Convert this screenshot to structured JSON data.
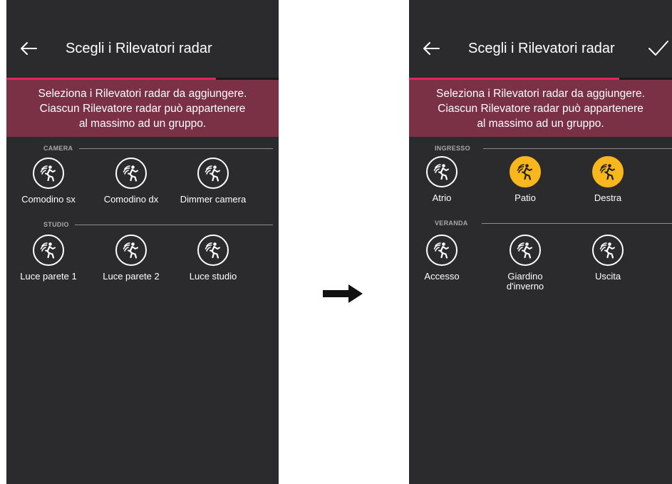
{
  "colors": {
    "background": "#2b2b2d",
    "accent": "#e0265b",
    "banner": "#7a3045",
    "selected": "#f7b71d"
  },
  "screens": [
    {
      "title": "Scegli i Rilevatori radar",
      "progress": 0.77,
      "instruction": [
        "Seleziona i Rilevatori radar da aggiungere.",
        "Ciascun Rilevatore radar può appartenere",
        "al massimo ad un gruppo."
      ],
      "groups": [
        {
          "name": "CAMERA",
          "devices": [
            {
              "label": "Comodino sx",
              "selected": false,
              "icon": "radar-motion-icon"
            },
            {
              "label": "Comodino dx",
              "selected": false,
              "icon": "radar-motion-icon"
            },
            {
              "label": "Dimmer camera",
              "selected": false,
              "icon": "radar-motion-icon"
            }
          ]
        },
        {
          "name": "STUDIO",
          "devices": [
            {
              "label": "Luce parete 1",
              "selected": false,
              "icon": "radar-motion-icon"
            },
            {
              "label": "Luce parete 2",
              "selected": false,
              "icon": "radar-motion-icon"
            },
            {
              "label": "Luce studio",
              "selected": false,
              "icon": "radar-motion-icon"
            }
          ]
        }
      ]
    },
    {
      "title": "Scegli i Rilevatori radar",
      "progress": 0.8,
      "show_confirm": true,
      "instruction": [
        "Seleziona i Rilevatori radar da aggiungere.",
        "Ciascun Rilevatore radar può appartenere",
        "al massimo ad un gruppo."
      ],
      "groups": [
        {
          "name": "INGRESSO",
          "devices": [
            {
              "label": "Atrio",
              "selected": false,
              "icon": "radar-motion-icon"
            },
            {
              "label": "Patio",
              "selected": true,
              "icon": "radar-motion-icon"
            },
            {
              "label": "Destra",
              "selected": true,
              "icon": "radar-motion-icon"
            }
          ]
        },
        {
          "name": "VERANDA",
          "devices": [
            {
              "label": "Accesso",
              "selected": false,
              "icon": "radar-motion-icon"
            },
            {
              "label": "Giardino\nd'inverno",
              "selected": false,
              "icon": "radar-motion-icon"
            },
            {
              "label": "Uscita",
              "selected": false,
              "icon": "radar-motion-icon"
            }
          ]
        }
      ]
    }
  ]
}
